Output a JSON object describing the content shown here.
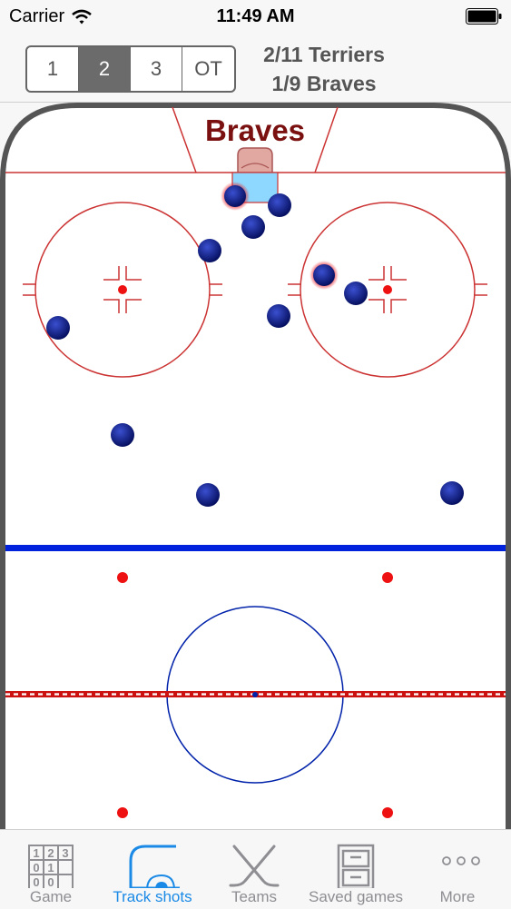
{
  "status": {
    "carrier": "Carrier",
    "time": "11:49 AM"
  },
  "periods": {
    "items": [
      "1",
      "2",
      "3",
      "OT"
    ],
    "selected_index": 1
  },
  "score": {
    "home": "2/11 Terriers",
    "away": "1/9 Braves"
  },
  "rink": {
    "team_label": "Braves",
    "colors": {
      "boards": "#555555",
      "red_line": "#cc0000",
      "blue_line": "#0022dd",
      "puck": "#0a1a8a",
      "goal_puck_glow": "#e8202a",
      "crease": "#8ed8ff"
    }
  },
  "tabs": [
    {
      "label": "Game",
      "icon": "scoreboard-icon"
    },
    {
      "label": "Track shots",
      "icon": "rink-icon",
      "active": true
    },
    {
      "label": "Teams",
      "icon": "hockey-sticks-icon"
    },
    {
      "label": "Saved games",
      "icon": "file-cabinet-icon"
    },
    {
      "label": "More",
      "icon": "more-dots-icon"
    }
  ]
}
